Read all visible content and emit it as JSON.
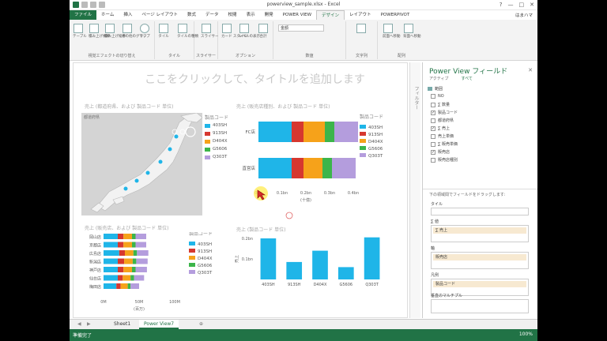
{
  "window": {
    "title": "powerview_sample.xlsx - Excel",
    "controls": [
      "?",
      "—",
      "□",
      "✕"
    ]
  },
  "ribbon_tabs": [
    "ファイル",
    "ホーム",
    "挿入",
    "ページ レイアウト",
    "数式",
    "データ",
    "校閲",
    "表示",
    "開発",
    "POWER VIEW",
    "デザイン",
    "レイアウト",
    "POWERPIVOT"
  ],
  "active_tab": "デザイン",
  "user_name": "はまハマ",
  "ribbon_buttons": [
    {
      "label": "テーブル"
    },
    {
      "label": "積み上げ横棒"
    },
    {
      "label": "積み上げ縦棒"
    },
    {
      "label": "その他のグラフ"
    },
    {
      "label": "マップ"
    },
    {
      "label": "タイル"
    },
    {
      "label": "タイルの種類"
    },
    {
      "label": "スライサー"
    },
    {
      "label": "カード スタイル"
    },
    {
      "label": "レベルの表示"
    },
    {
      "label": "合計"
    },
    {
      "label": "配置"
    },
    {
      "label": "前面へ移動"
    },
    {
      "label": "背面へ移動"
    }
  ],
  "ribbon_groups": [
    "視覚エフェクトの切り替え",
    "タイル",
    "スライサー",
    "オプション",
    "数値",
    "文字列",
    "配列"
  ],
  "number_format": "金額",
  "canvas": {
    "placeholder_title": "ここをクリックして、タイトルを追加します"
  },
  "visuals": {
    "map_title": "売上 (都道府県、および 製品コード 単位)",
    "map_legend_title": "製品コード",
    "stacked_bar_title": "売上 (販売店種別、および 製品コード 単位)",
    "stacked_bar_legend_title": "製品コード",
    "stacked_bar_axis_label": "(十億)",
    "small_bar_title": "売上 (販売店、および 製品コード 単位)",
    "small_bar_legend_title": "製品コード",
    "small_bar_axis_label": "(百万)",
    "column_title": "売上 (製品コード 単位)",
    "column_ylabel": "売上"
  },
  "chart_data": [
    {
      "type": "map",
      "title": "売上 (都道府県、および 製品コード 単位)",
      "legend": [
        "403SH",
        "913SH",
        "D404X",
        "G5606",
        "Q303T"
      ],
      "legend_colors": [
        "#1fb5e8",
        "#d6382f",
        "#f6a21a",
        "#3cb54a",
        "#b49ddd"
      ],
      "map_label": "都道府県"
    },
    {
      "type": "bar",
      "stacked": true,
      "orientation": "horizontal",
      "title": "売上 (販売店種別、および 製品コード 単位)",
      "categories": [
        "FC店",
        "直営店"
      ],
      "xlabel": "(十億)",
      "x_ticks": [
        "0bn",
        "0.1bn",
        "0.2bn",
        "0.3bn",
        "0.4bn"
      ],
      "xlim": [
        0,
        0.4
      ],
      "series": [
        {
          "name": "403SH",
          "values": [
            0.14,
            0.14
          ]
        },
        {
          "name": "913SH",
          "values": [
            0.05,
            0.05
          ]
        },
        {
          "name": "D404X",
          "values": [
            0.09,
            0.08
          ]
        },
        {
          "name": "G5606",
          "values": [
            0.04,
            0.04
          ]
        },
        {
          "name": "Q303T",
          "values": [
            0.1,
            0.1
          ]
        }
      ],
      "colors": [
        "#1fb5e8",
        "#d6382f",
        "#f6a21a",
        "#3cb54a",
        "#b49ddd"
      ]
    },
    {
      "type": "bar",
      "stacked": true,
      "orientation": "horizontal",
      "title": "売上 (販売店、および 製品コード 単位)",
      "categories": [
        "岡山店",
        "京都店",
        "広島店",
        "新潟店",
        "神戸店",
        "仙台店",
        "梅田店"
      ],
      "xlabel": "(百万)",
      "x_ticks": [
        "0M",
        "50M",
        "100M"
      ],
      "xlim": [
        0,
        100
      ],
      "series": [
        {
          "name": "403SH",
          "values": [
            20,
            20,
            22,
            20,
            20,
            20,
            18
          ]
        },
        {
          "name": "913SH",
          "values": [
            8,
            8,
            8,
            9,
            8,
            7,
            6
          ]
        },
        {
          "name": "D404X",
          "values": [
            12,
            12,
            12,
            12,
            12,
            11,
            10
          ]
        },
        {
          "name": "G5606",
          "values": [
            5,
            5,
            5,
            5,
            5,
            5,
            4
          ]
        },
        {
          "name": "Q303T",
          "values": [
            15,
            15,
            16,
            16,
            16,
            14,
            12
          ]
        }
      ],
      "colors": [
        "#1fb5e8",
        "#d6382f",
        "#f6a21a",
        "#3cb54a",
        "#b49ddd"
      ]
    },
    {
      "type": "bar",
      "orientation": "vertical",
      "title": "売上 (製品コード 単位)",
      "ylabel": "売上",
      "categories": [
        "403SH",
        "913SH",
        "D404X",
        "G5606",
        "Q303T"
      ],
      "y_ticks": [
        "0.1bn",
        "0.2bn"
      ],
      "ylim": [
        0,
        0.2
      ],
      "values": [
        0.2,
        0.085,
        0.14,
        0.06,
        0.205
      ],
      "color": "#1fb5e8"
    }
  ],
  "field_pane": {
    "title": "Power View フィールド",
    "tabs": [
      "アクティブ",
      "すべて"
    ],
    "table_name": "範囲",
    "fields": [
      {
        "label": "NO",
        "checked": false
      },
      {
        "label": "∑ 数量",
        "checked": false
      },
      {
        "label": "製品コード",
        "checked": true
      },
      {
        "label": "都道府県",
        "checked": false
      },
      {
        "label": "∑ 売上",
        "checked": true
      },
      {
        "label": "売上単価",
        "checked": false
      },
      {
        "label": "∑ 販売単価",
        "checked": false
      },
      {
        "label": "販売店",
        "checked": true
      },
      {
        "label": "販売店種別",
        "checked": false
      }
    ],
    "drag_hint": "下の領域間でフィールドをドラッグします:",
    "areas": [
      {
        "label": "タイル",
        "value": ""
      },
      {
        "label": "∑ 値",
        "value": "∑ 売上"
      },
      {
        "label": "軸",
        "value": "販売店"
      },
      {
        "label": "凡例",
        "value": "製品コード"
      },
      {
        "label": "垂直のマルチプル",
        "value": ""
      }
    ]
  },
  "sheets": [
    "Sheet1",
    "Power View7"
  ],
  "active_sheet": "Power View7",
  "status": {
    "left": "準備完了",
    "zoom": "100%"
  }
}
